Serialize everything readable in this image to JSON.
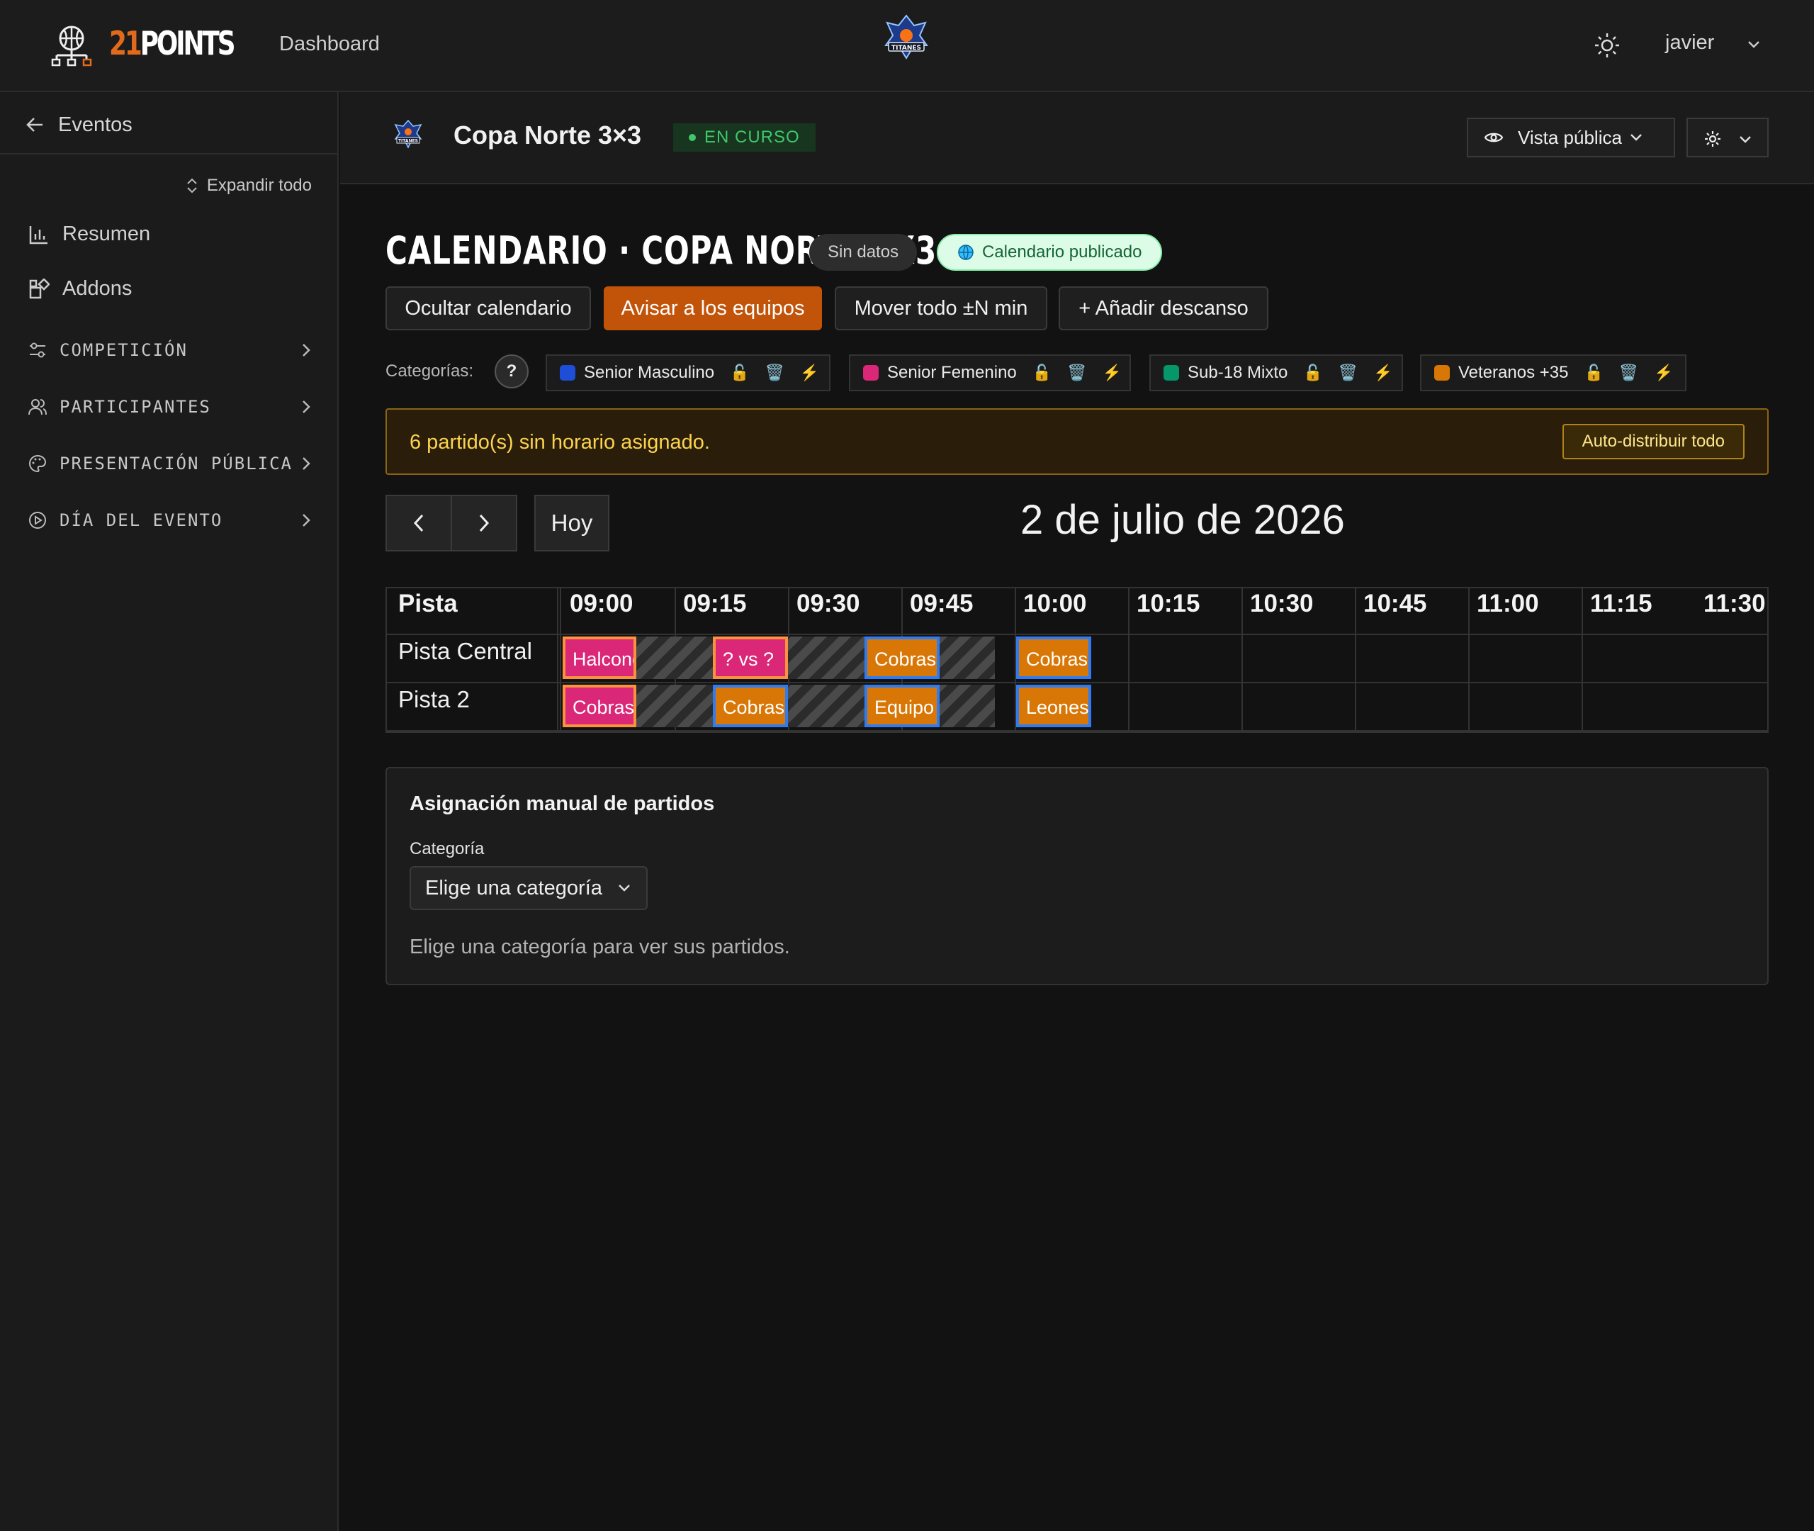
{
  "topbar": {
    "logo_number": "21",
    "logo_word": "POINTS",
    "nav_dashboard": "Dashboard",
    "user_name": "javier",
    "center_badge_text": "TITANES"
  },
  "sidebar": {
    "back_label": "Eventos",
    "expand_label": "Expandir todo",
    "items": [
      {
        "label": "Resumen",
        "icon": "bar-chart-icon"
      },
      {
        "label": "Addons",
        "icon": "puzzle-icon"
      }
    ],
    "groups": [
      {
        "label": "COMPETICIÓN",
        "icon": "sliders-icon"
      },
      {
        "label": "PARTICIPANTES",
        "icon": "users-icon"
      },
      {
        "label": "PRESENTACIÓN PÚBLICA",
        "icon": "palette-icon"
      },
      {
        "label": "DÍA DEL EVENTO",
        "icon": "play-circle-icon"
      }
    ]
  },
  "event": {
    "title": "Copa Norte 3×3",
    "status": "EN CURSO",
    "status_color": "#3fc96a",
    "logo_text": "TITANES",
    "vista_label": "Vista pública"
  },
  "calendar": {
    "title": "CALENDARIO · COPA NORTE 3X3",
    "pill_data": "Sin datos",
    "pill_published": "Calendario publicado",
    "actions": {
      "hide": "Ocultar calendario",
      "notify": "Avisar a los equipos",
      "move": "Mover todo ±N min",
      "add_break": "+ Añadir descanso"
    },
    "categories_label": "Categorías:",
    "help_label": "?",
    "categories": [
      {
        "name": "Senior Masculino",
        "color": "#1d4ed8"
      },
      {
        "name": "Senior Femenino",
        "color": "#db2777"
      },
      {
        "name": "Sub-18 Mixto",
        "color": "#059669"
      },
      {
        "name": "Veteranos +35",
        "color": "#d97706"
      }
    ],
    "category_icons": {
      "lock": "🔓",
      "trash": "🗑️",
      "bolt": "⚡"
    },
    "warning": "6 partido(s) sin horario asignado.",
    "auto_distribute": "Auto-distribuir todo",
    "today": "Hoy",
    "date": "2 de julio de 2026",
    "grid": {
      "court_header": "Pista",
      "times": [
        "09:00",
        "09:15",
        "09:30",
        "09:45",
        "10:00",
        "10:15",
        "10:30",
        "10:45",
        "11:00",
        "11:15",
        "11:30"
      ],
      "courts": [
        "Pista Central",
        "Pista 2"
      ],
      "matches": [
        [
          "Halcones",
          "? vs ?",
          "Cobras",
          "Cobras"
        ],
        [
          "Cobras",
          "Cobras",
          "Equipo",
          "Leones"
        ]
      ]
    }
  },
  "manual": {
    "title": "Asignación manual de partidos",
    "category_label": "Categoría",
    "select_value": "Elige una categoría",
    "hint": "Elige una categoría para ver sus partidos."
  }
}
